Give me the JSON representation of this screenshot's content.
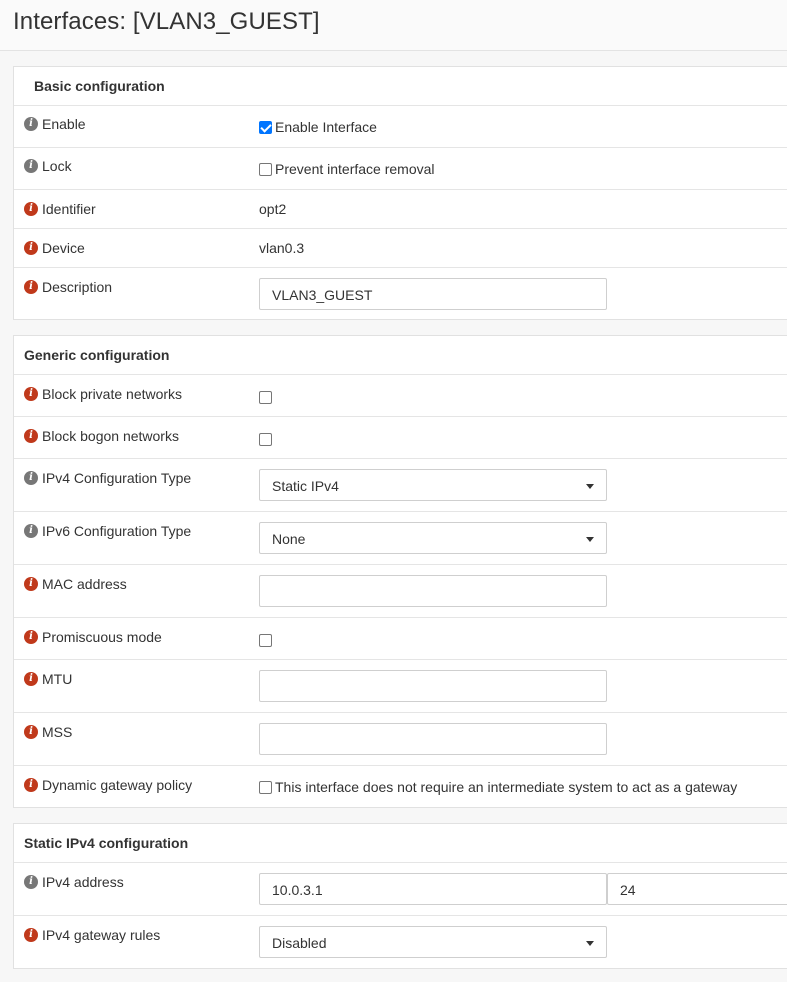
{
  "page": {
    "title": "Interfaces: [VLAN3_GUEST]"
  },
  "basic": {
    "title": "Basic configuration",
    "enable": {
      "label": "Enable",
      "option": "Enable Interface"
    },
    "lock": {
      "label": "Lock",
      "option": "Prevent interface removal"
    },
    "identifier": {
      "label": "Identifier",
      "value": "opt2"
    },
    "device": {
      "label": "Device",
      "value": "vlan0.3"
    },
    "description": {
      "label": "Description",
      "value": "VLAN3_GUEST"
    }
  },
  "generic": {
    "title": "Generic configuration",
    "block_private": {
      "label": "Block private networks"
    },
    "block_bogon": {
      "label": "Block bogon networks"
    },
    "ipv4_type": {
      "label": "IPv4 Configuration Type",
      "value": "Static IPv4"
    },
    "ipv6_type": {
      "label": "IPv6 Configuration Type",
      "value": "None"
    },
    "mac": {
      "label": "MAC address",
      "value": ""
    },
    "promisc": {
      "label": "Promiscuous mode"
    },
    "mtu": {
      "label": "MTU",
      "value": ""
    },
    "mss": {
      "label": "MSS",
      "value": ""
    },
    "dyn_gw": {
      "label": "Dynamic gateway policy",
      "option": "This interface does not require an intermediate system to act as a gateway"
    }
  },
  "static_ipv4": {
    "title": "Static IPv4 configuration",
    "address": {
      "label": "IPv4 address",
      "value": "10.0.3.1",
      "prefix": "24"
    },
    "gateway_rules": {
      "label": "IPv4 gateway rules",
      "value": "Disabled"
    }
  },
  "colors": {
    "info_grey": "#777777",
    "info_red": "#c0391b",
    "checkbox_checked": "#0075ff"
  },
  "icons": {
    "info": "info-icon",
    "dropdown": "caret-down-icon",
    "checkbox": "checkbox"
  }
}
